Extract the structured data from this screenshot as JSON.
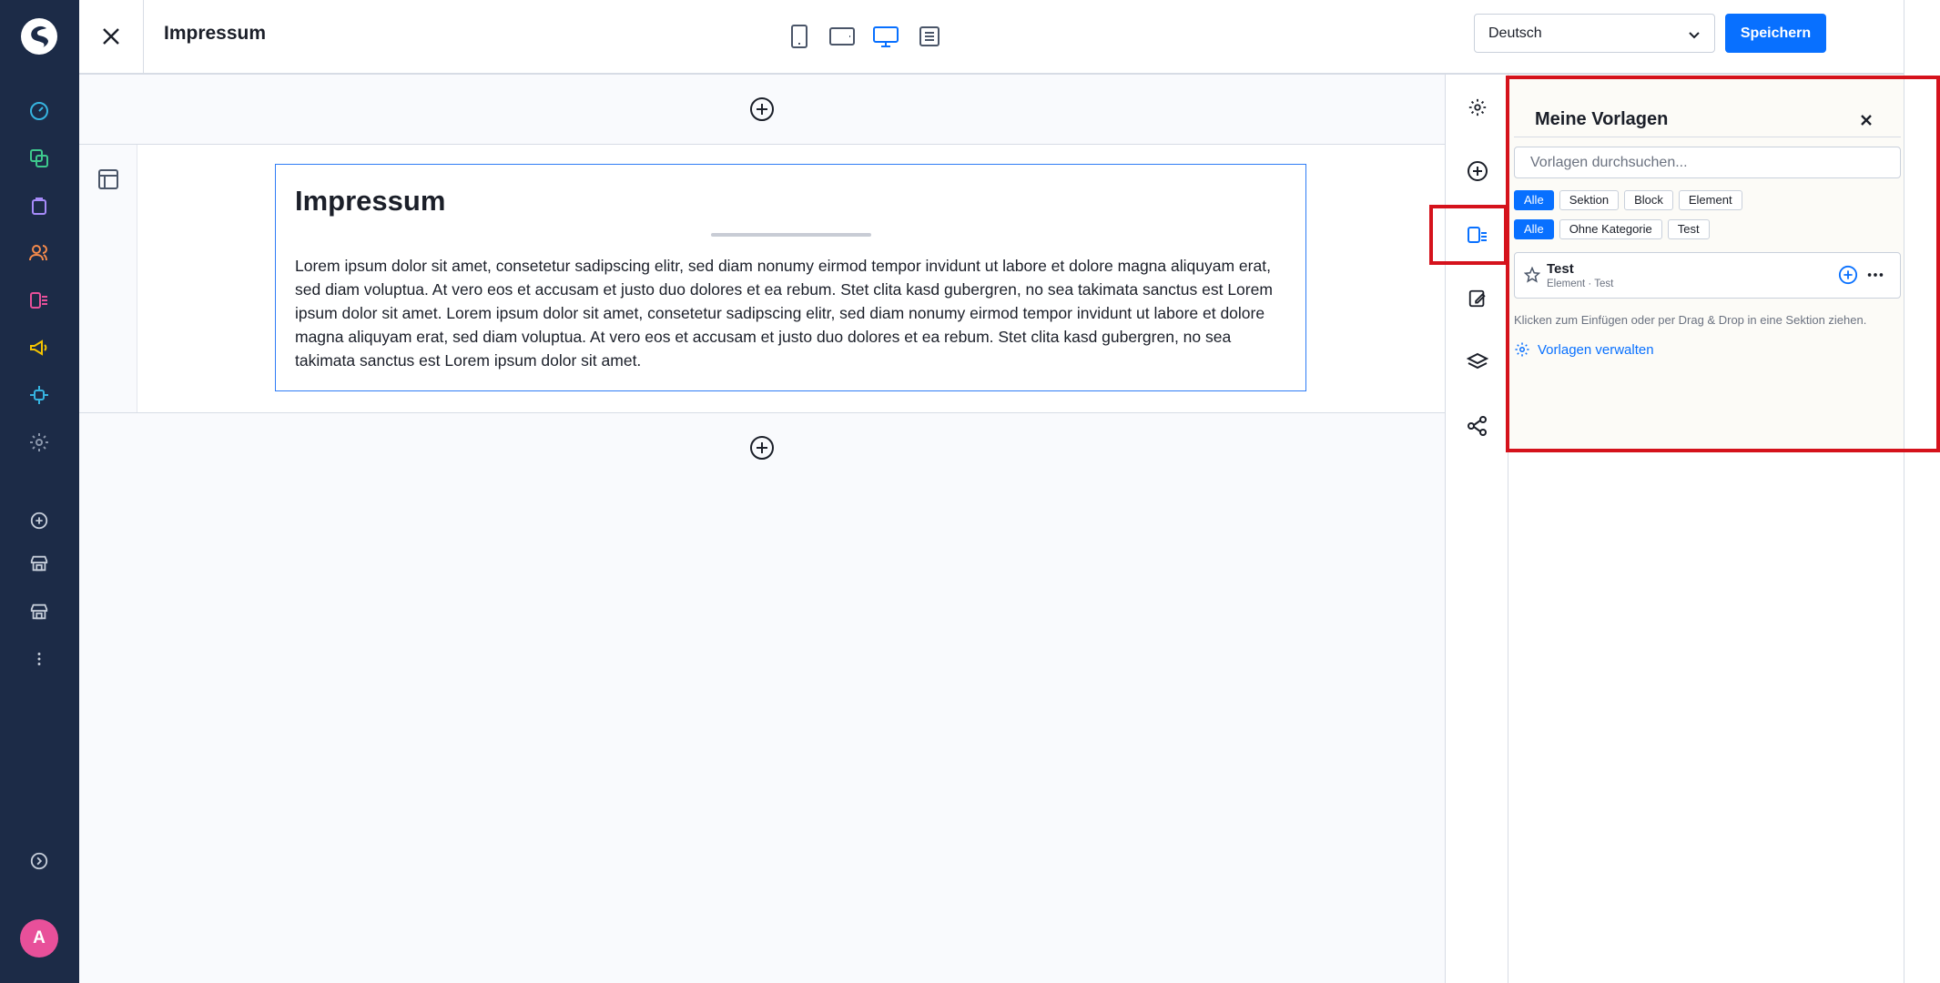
{
  "header": {
    "title": "Impressum",
    "language": "Deutsch",
    "save_label": "Speichern"
  },
  "block": {
    "heading": "Impressum",
    "text": "Lorem ipsum dolor sit amet, consetetur sadipscing elitr, sed diam nonumy eirmod tempor invidunt ut labore et dolore magna aliquyam erat, sed diam voluptua. At vero eos et accusam et justo duo dolores et ea rebum. Stet clita kasd gubergren, no sea takimata sanctus est Lorem ipsum dolor sit amet. Lorem ipsum dolor sit amet, consetetur sadipscing elitr, sed diam nonumy eirmod tempor invidunt ut labore et dolore magna aliquyam erat, sed diam voluptua. At vero eos et accusam et justo duo dolores et ea rebum. Stet clita kasd gubergren, no sea takimata sanctus est Lorem ipsum dolor sit amet."
  },
  "nav": {
    "avatar_initial": "A",
    "icons": [
      "dashboard-icon",
      "catalog-icon",
      "orders-icon",
      "customers-icon",
      "content-icon",
      "marketing-icon",
      "extensions-icon",
      "settings-icon",
      "add-icon",
      "sales-channel-icon",
      "sales-channel-icon",
      "more-icon",
      "collapse-icon"
    ]
  },
  "panel": {
    "title": "Meine Vorlagen",
    "search_placeholder": "Vorlagen durchsuchen...",
    "type_filters": [
      "Alle",
      "Sektion",
      "Block",
      "Element"
    ],
    "category_filters": [
      "Alle",
      "Ohne Kategorie",
      "Test"
    ],
    "template": {
      "name": "Test",
      "meta": "Element · Test"
    },
    "hint": "Klicken zum Einfügen oder per Drag & Drop in eine Sektion ziehen.",
    "manage_label": "Vorlagen verwalten"
  },
  "colors": {
    "primary": "#0870ff",
    "nav_bg": "#1c2b47",
    "highlight": "#d5121c"
  }
}
